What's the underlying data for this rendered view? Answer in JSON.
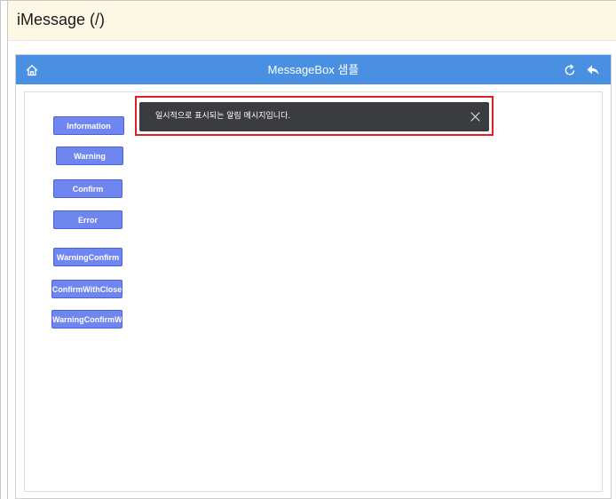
{
  "doc": {
    "title": "iMessage (/)"
  },
  "app": {
    "title": "MessageBox 샘플",
    "topbar_color": "#4a90e2",
    "icons": {
      "home": "home-icon",
      "refresh": "refresh-icon",
      "back": "reply-arrow-icon"
    }
  },
  "buttons": {
    "information": "Information",
    "warning": "Warning",
    "confirm": "Confirm",
    "error": "Error",
    "warning_confirm": "WarningConfirm",
    "confirm_with_close": "ConfirmWithClose",
    "warning_confirm_wi": "WarningConfirmWi"
  },
  "toast": {
    "message": "일시적으로 표시되는 알림 메시지입니다.",
    "close_icon": "close-icon"
  },
  "colors": {
    "button_bg": "#6f85f0",
    "toast_bg": "#3b3c40",
    "highlight": "#e02020"
  }
}
